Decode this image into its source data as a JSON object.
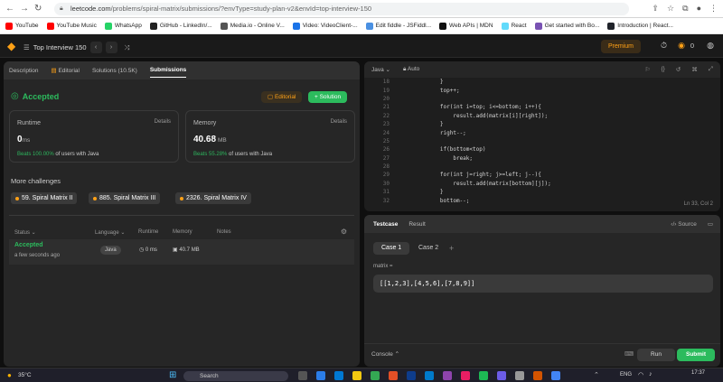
{
  "browser": {
    "url_host": "leetcode.com",
    "url_path": "/problems/spiral-matrix/submissions/?envType=study-plan-v2&envId=top-interview-150",
    "bookmarks": [
      {
        "label": "YouTube",
        "color": "#ff0000"
      },
      {
        "label": "YouTube Music",
        "color": "#ff0000"
      },
      {
        "label": "WhatsApp",
        "color": "#25d366"
      },
      {
        "label": "GitHub - LinkedIn/...",
        "color": "#222222"
      },
      {
        "label": "Media.io - Online V...",
        "color": "#555555"
      },
      {
        "label": "Video: VideoClient-...",
        "color": "#1a73e8"
      },
      {
        "label": "Edit fiddle - JSFiddl...",
        "color": "#4a90e2"
      },
      {
        "label": "Web APIs | MDN",
        "color": "#111111"
      },
      {
        "label": "React",
        "color": "#61dafb"
      },
      {
        "label": "Get started with Bo...",
        "color": "#7952b3"
      },
      {
        "label": "Introduction | React...",
        "color": "#20232a"
      }
    ]
  },
  "nav": {
    "list_title": "Top Interview 150",
    "premium": "Premium",
    "coins": "0"
  },
  "left_tabs": [
    "Description",
    "Editorial",
    "Solutions (10.5K)",
    "Submissions"
  ],
  "submission": {
    "status": "Accepted",
    "editorial_btn": "Editorial",
    "solution_btn": "+ Solution",
    "runtime_label": "Runtime",
    "runtime_value": "0",
    "runtime_unit": "ms",
    "runtime_beats": "Beats 100.00%",
    "runtime_beats_suffix": "of users with Java",
    "memory_label": "Memory",
    "memory_value": "40.68",
    "memory_unit": "MB",
    "memory_beats": "Beats 55.28%",
    "memory_beats_suffix": "of users with Java",
    "details": "Details"
  },
  "challenges": {
    "title": "More challenges",
    "items": [
      "59. Spiral Matrix II",
      "885. Spiral Matrix III",
      "2326. Spiral Matrix IV"
    ]
  },
  "table": {
    "headers": [
      "Status",
      "Language",
      "Runtime",
      "Memory",
      "Notes"
    ],
    "row": {
      "status": "Accepted",
      "time": "a few seconds ago",
      "lang": "Java",
      "runtime": "0 ms",
      "memory": "40.7 MB"
    }
  },
  "editor": {
    "lang": "Java",
    "mode": "Auto",
    "position": "Ln 33, Col 2",
    "lines": [
      {
        "n": "18",
        "t": "        }"
      },
      {
        "n": "19",
        "t": "        top++;"
      },
      {
        "n": "20",
        "t": ""
      },
      {
        "n": "21",
        "t": "        for(int i=top; i<=bottom; i++){"
      },
      {
        "n": "22",
        "t": "            result.add(matrix[i][right]);"
      },
      {
        "n": "23",
        "t": "        }"
      },
      {
        "n": "24",
        "t": "        right--;"
      },
      {
        "n": "25",
        "t": ""
      },
      {
        "n": "26",
        "t": "        if(bottom<top)"
      },
      {
        "n": "27",
        "t": "            break;"
      },
      {
        "n": "28",
        "t": ""
      },
      {
        "n": "29",
        "t": "        for(int j=right; j>=left; j--){"
      },
      {
        "n": "30",
        "t": "            result.add(matrix[bottom][j]);"
      },
      {
        "n": "31",
        "t": "        }"
      },
      {
        "n": "32",
        "t": "        bottom--;"
      }
    ]
  },
  "testpanel": {
    "tab_testcase": "Testcase",
    "tab_result": "Result",
    "source": "Source",
    "case1": "Case 1",
    "case2": "Case 2",
    "param_label": "matrix =",
    "param_value": "[[1,2,3],[4,5,6],[7,8,9]]",
    "console": "Console",
    "run": "Run",
    "submit": "Submit"
  },
  "taskbar": {
    "weather": "35°C",
    "search": "Search",
    "lang": "ENG",
    "time": "17:37"
  },
  "colors": {
    "accent_orange": "#ffa116",
    "accent_green": "#2cbb5d",
    "beats_green": "#2db55d"
  }
}
